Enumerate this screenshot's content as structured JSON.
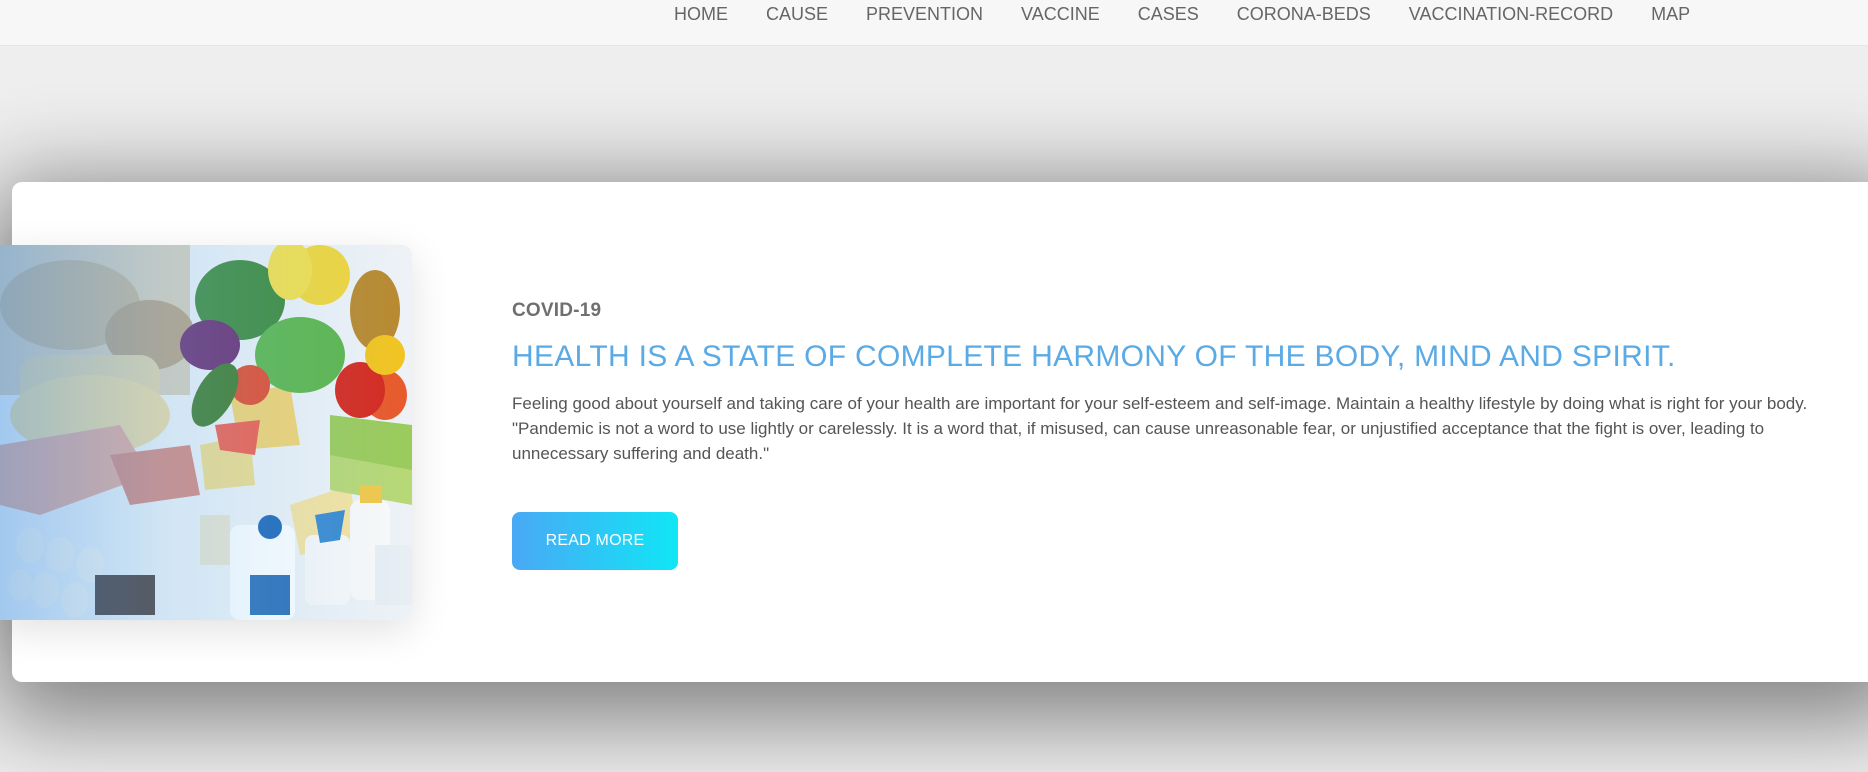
{
  "nav": {
    "items": [
      {
        "label": "HOME"
      },
      {
        "label": "CAUSE"
      },
      {
        "label": "PREVENTION"
      },
      {
        "label": "VACCINE"
      },
      {
        "label": "CASES"
      },
      {
        "label": "CORONA-BEDS"
      },
      {
        "label": "VACCINATION-RECORD"
      },
      {
        "label": "MAP"
      }
    ]
  },
  "feature": {
    "eyebrow": "COVID-19",
    "headline": "HEALTH IS A STATE OF COMPLETE HARMONY OF THE BODY, MIND AND SPIRIT.",
    "body": "Feeling good about yourself and taking care of your health are important for your self-esteem and self-image. Maintain a healthy lifestyle by doing what is right for your body. \"Pandemic is not a word to use lightly or carelessly. It is a word that, if misused, can cause unreasonable fear, or unjustified acceptance that the fight is over, leading to unnecessary suffering and death.\"",
    "button_label": "READ MORE",
    "image_subject": "healthy-food-groups-photo"
  },
  "colors": {
    "accent": "#5aaae6",
    "button_start": "#4aa8f5",
    "button_end": "#10e6f5"
  }
}
